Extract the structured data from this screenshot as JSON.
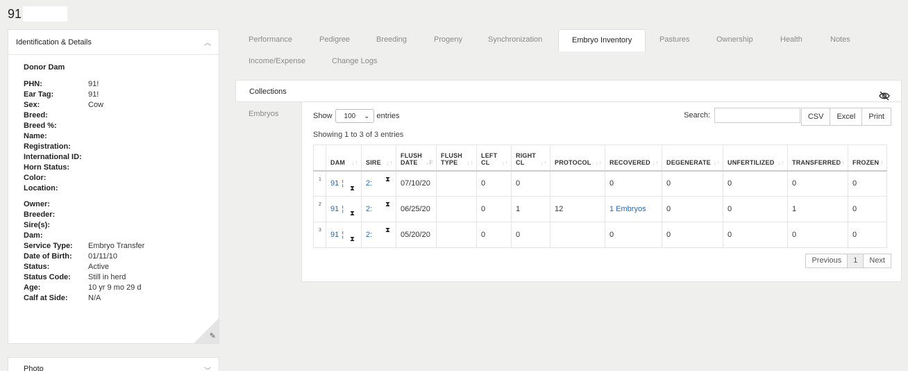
{
  "page": {
    "title": "91"
  },
  "left": {
    "header": "Identification & Details",
    "subtitle": "Donor Dam",
    "rows1": [
      {
        "k": "PHN:",
        "v": "91!"
      },
      {
        "k": "Ear Tag:",
        "v": "91!"
      },
      {
        "k": "Sex:",
        "v": "Cow"
      },
      {
        "k": "Breed:",
        "v": ""
      },
      {
        "k": "Breed %:",
        "v": ""
      },
      {
        "k": "Name:",
        "v": ""
      },
      {
        "k": "Registration:",
        "v": ""
      },
      {
        "k": "International ID:",
        "v": ""
      },
      {
        "k": "Horn Status:",
        "v": ""
      },
      {
        "k": "Color:",
        "v": ""
      },
      {
        "k": "Location:",
        "v": ""
      }
    ],
    "rows2": [
      {
        "k": "Owner:",
        "v": ""
      },
      {
        "k": "Breeder:",
        "v": ""
      },
      {
        "k": "Sire(s):",
        "v": ""
      },
      {
        "k": "Dam:",
        "v": ""
      },
      {
        "k": "Service Type:",
        "v": "Embryo Transfer"
      },
      {
        "k": "Date of Birth:",
        "v": "01/11/10"
      },
      {
        "k": "Status:",
        "v": "Active"
      },
      {
        "k": "Status Code:",
        "v": "Still in herd"
      },
      {
        "k": "Age:",
        "v": "10 yr 9 mo 29 d"
      },
      {
        "k": "Calf at Side:",
        "v": "N/A"
      }
    ],
    "photo_header": "Photo"
  },
  "tabs": [
    "Performance",
    "Pedigree",
    "Breeding",
    "Progeny",
    "Synchronization",
    "Embryo Inventory",
    "Pastures",
    "Ownership",
    "Health",
    "Notes",
    "Income/Expense",
    "Change Logs"
  ],
  "active_tab": "Embryo Inventory",
  "subtabs": [
    "Collections",
    "Embryos"
  ],
  "controls": {
    "show_label": "Show",
    "show_value": "100",
    "entries_label": "entries",
    "search_label": "Search:",
    "csv": "CSV",
    "excel": "Excel",
    "print": "Print",
    "showing": "Showing 1 to 3 of 3 entries"
  },
  "table": {
    "headers": [
      [
        "DAM"
      ],
      [
        "SIRE"
      ],
      [
        "FLUSH",
        "DATE"
      ],
      [
        "FLUSH",
        "TYPE"
      ],
      [
        "LEFT",
        "CL"
      ],
      [
        "RIGHT",
        "CL"
      ],
      [
        "PROTOCOL"
      ],
      [
        "RECOVERED"
      ],
      [
        "DEGENERATE"
      ],
      [
        "UNFERTILIZED"
      ],
      [
        "TRANSFERRED"
      ],
      [
        "FROZEN"
      ]
    ],
    "rows": [
      {
        "idx": "1",
        "dam": "91",
        "dam2": "¦",
        "sire": "2:",
        "flush_date": "07/10/20",
        "flush_type": "",
        "left_cl": "0",
        "right_cl": "0",
        "protocol": "",
        "recovered": "0",
        "degenerate": "0",
        "unfertilized": "0",
        "transferred": "0",
        "frozen": "0"
      },
      {
        "idx": "2",
        "dam": "91",
        "dam2": "¦",
        "sire": "2:",
        "flush_date": "06/25/20",
        "flush_type": "",
        "left_cl": "0",
        "right_cl": "1",
        "protocol": "12",
        "recovered": "1 Embryos",
        "degenerate": "0",
        "unfertilized": "0",
        "transferred": "1",
        "frozen": "0"
      },
      {
        "idx": "3",
        "dam": "91",
        "dam2": "¦",
        "sire": "2:",
        "flush_date": "05/20/20",
        "flush_type": "",
        "left_cl": "0",
        "right_cl": "0",
        "protocol": "",
        "recovered": "0",
        "degenerate": "0",
        "unfertilized": "0",
        "transferred": "0",
        "frozen": "0"
      }
    ]
  },
  "pager": {
    "previous": "Previous",
    "page": "1",
    "next": "Next"
  }
}
